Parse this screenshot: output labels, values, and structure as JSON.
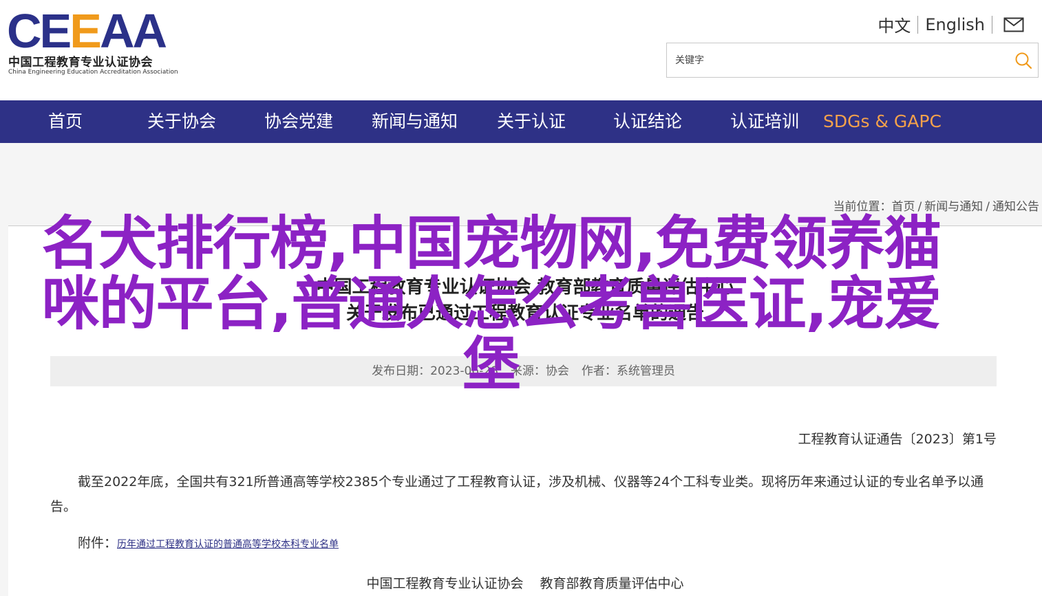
{
  "header": {
    "logo_mark_a": "CE",
    "logo_mark_b": "E",
    "logo_mark_c": "AA",
    "logo_cn": "中国工程教育专业认证协会",
    "logo_en": "China Engineering Education Accreditation Association",
    "lang_cn": "中文",
    "lang_en": "English",
    "search_placeholder": "关键字"
  },
  "nav": {
    "items": [
      "首页",
      "关于协会",
      "协会党建",
      "新闻与通知",
      "关于认证",
      "认证结论",
      "认证培训",
      "SDGs & GAPC"
    ]
  },
  "breadcrumb": {
    "prefix": "当前位置：",
    "items": [
      "首页",
      "新闻与通知",
      "通知公告"
    ],
    "separator": "/"
  },
  "article": {
    "title_line1": "中国工程教育专业认证协会 教育部教育质量评估中心",
    "title_line2": "关于发布已通过工程教育认证专业名单的通告",
    "meta_date": "发布日期：2023-06-28",
    "meta_source": "来源：协会",
    "meta_author": "作者：系统管理员",
    "notice_no": "工程教育认证通告〔2023〕第1号",
    "paragraph": "截至2022年底，全国共有321所普通高等学校2385个专业通过了工程教育认证，涉及机械、仪器等24个工科专业类。现将历年来通过认证的专业名单予以通告。",
    "attach_label": "附件：",
    "attach_link": "历年通过工程教育认证的普通高等学校本科专业名单",
    "sign_a": "中国工程教育专业认证协会",
    "sign_b": "教育部教育质量评估中心"
  },
  "overlay": {
    "headline": "名犬排行榜,中国宠物网,免费领养猫咪的平台,普通人怎么考兽医证,宠爱堡"
  },
  "colors": {
    "nav_bg": "#2e3186",
    "nav_highlight": "#f4a14b",
    "overlay_text": "#8c22c4",
    "logo_blue": "#2b3189",
    "logo_orange": "#f09a1b"
  }
}
